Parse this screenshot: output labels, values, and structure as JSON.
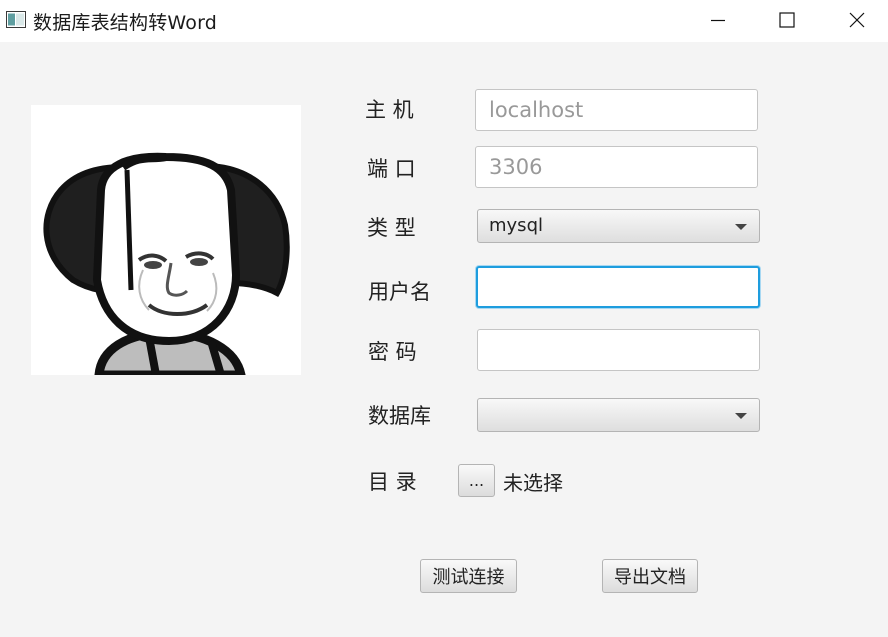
{
  "window": {
    "title": "数据库表结构转Word",
    "minimize_icon": "minimize-icon",
    "maximize_icon": "maximize-icon",
    "close_icon": "close-icon"
  },
  "avatar": {
    "icon": "meme-face-image"
  },
  "form": {
    "host": {
      "label": "主 机",
      "value": "localhost"
    },
    "port": {
      "label": "端 口",
      "value": "3306"
    },
    "type": {
      "label": "类 型",
      "value": "mysql"
    },
    "username": {
      "label": "用户名",
      "value": ""
    },
    "password": {
      "label": "密 码",
      "value": ""
    },
    "database": {
      "label": "数据库",
      "value": ""
    },
    "directory": {
      "label": "目 录",
      "browse_label": "...",
      "status": "未选择"
    }
  },
  "actions": {
    "test_label": "测试连接",
    "export_label": "导出文档"
  },
  "colors": {
    "focus": "#1e9dde",
    "background": "#f4f4f4"
  }
}
